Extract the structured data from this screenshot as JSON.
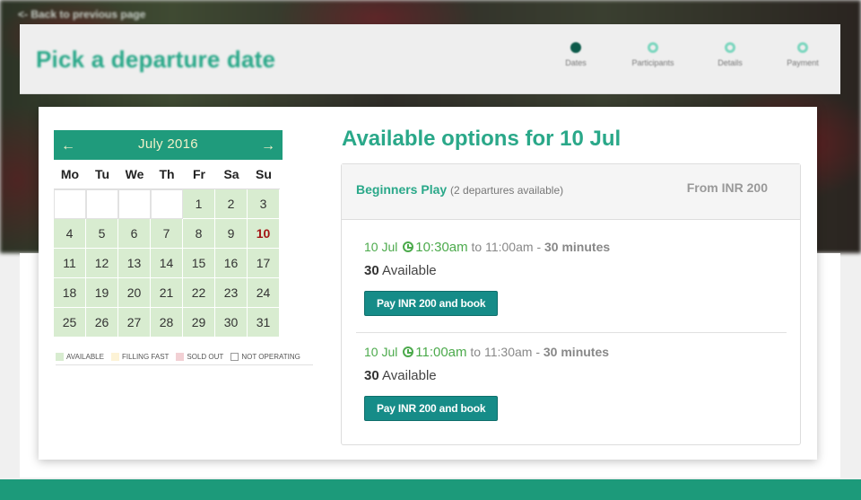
{
  "back_link": "<- Back to previous page",
  "page_title": "Pick a departure date",
  "steps": [
    {
      "label": "Dates",
      "active": true
    },
    {
      "label": "Participants",
      "active": false
    },
    {
      "label": "Details",
      "active": false
    },
    {
      "label": "Payment",
      "active": false
    }
  ],
  "calendar": {
    "month_label": "July 2016",
    "prev_label": "←",
    "next_label": "→",
    "weekdays": [
      "Mo",
      "Tu",
      "We",
      "Th",
      "Fr",
      "Sa",
      "Su"
    ],
    "leading_empty": 4,
    "days": [
      "1",
      "2",
      "3",
      "4",
      "5",
      "6",
      "7",
      "8",
      "9",
      "10",
      "11",
      "12",
      "13",
      "14",
      "15",
      "16",
      "17",
      "18",
      "19",
      "20",
      "21",
      "22",
      "23",
      "24",
      "25",
      "26",
      "27",
      "28",
      "29",
      "30",
      "31"
    ],
    "selected_day": "10",
    "legend": [
      {
        "label": "AVAILABLE",
        "color": "#d8ecd0"
      },
      {
        "label": "FILLING FAST",
        "color": "#fdf3d6"
      },
      {
        "label": "SOLD OUT",
        "color": "#f2d0d4"
      },
      {
        "label": "NOT OPERATING",
        "color": "#ffffff"
      }
    ]
  },
  "options": {
    "title": "Available options for 10 Jul",
    "product_name": "Beginners Play",
    "product_sub": "(2 departures available)",
    "price_from": "From INR 200",
    "slots": [
      {
        "date": "10 Jul",
        "start": "10:30am",
        "to": "to",
        "end": "11:00am",
        "sep": "-",
        "duration": "30 minutes",
        "available_count": "30",
        "available_label": "Available",
        "button": "Pay INR 200 and book"
      },
      {
        "date": "10 Jul",
        "start": "11:00am",
        "to": "to",
        "end": "11:30am",
        "sep": "-",
        "duration": "30 minutes",
        "available_count": "30",
        "available_label": "Available",
        "button": "Pay INR 200 and book"
      }
    ]
  },
  "colors": {
    "accent": "#2aa889",
    "calendar_header": "#1f9b7c",
    "button": "#168c88",
    "time_green": "#4caa4c",
    "selected_day": "#a31515"
  }
}
